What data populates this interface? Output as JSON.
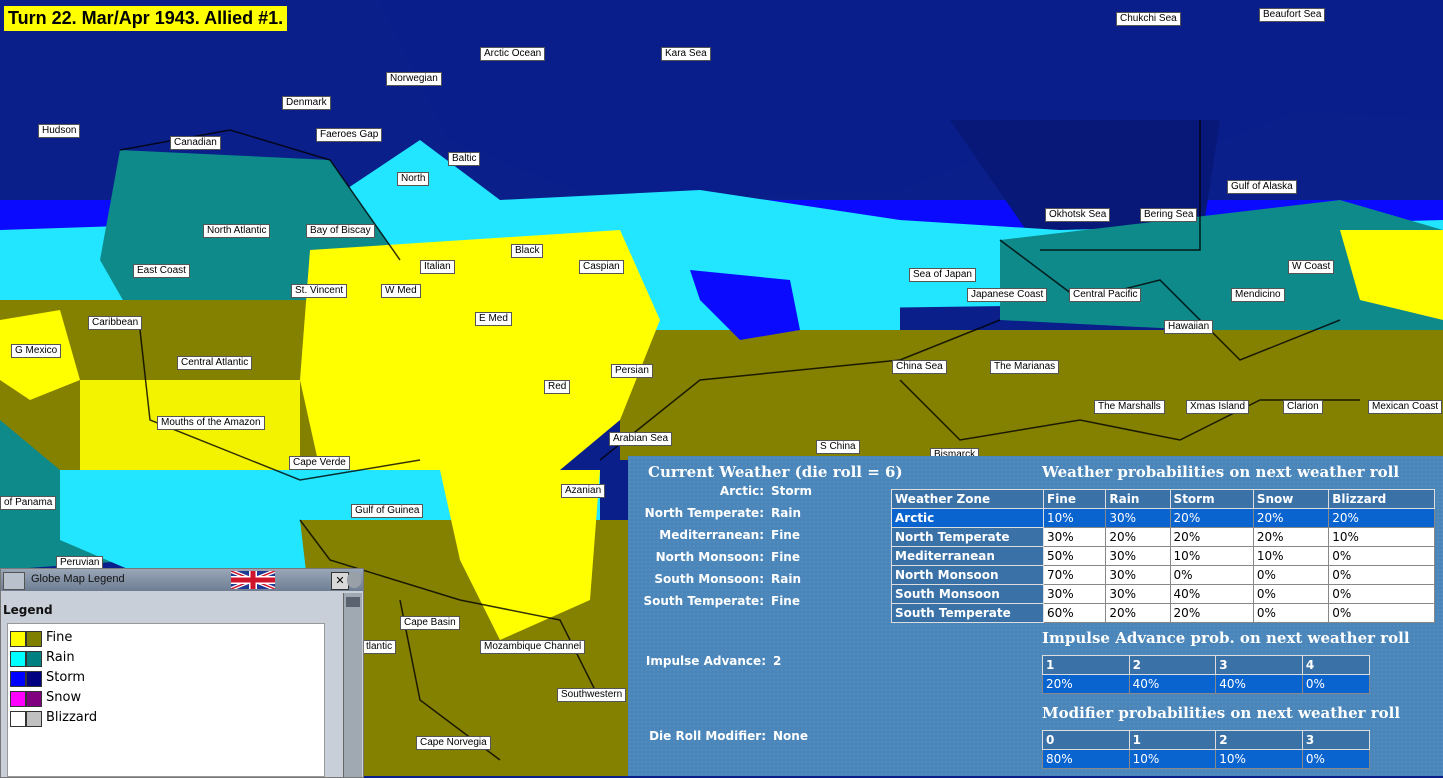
{
  "banner": "Turn 22.  Mar/Apr 1943.  Allied #1.",
  "map_labels": {
    "chukchi": "Chukchi Sea",
    "beaufort": "Beaufort Sea",
    "arctic_ocean": "Arctic Ocean",
    "kara": "Kara Sea",
    "norwegian": "Norwegian",
    "denmark": "Denmark",
    "hudson": "Hudson",
    "canadian": "Canadian",
    "faeroes": "Faeroes Gap",
    "baltic": "Baltic",
    "north": "North",
    "gulf_alaska": "Gulf of Alaska",
    "okhotsk": "Okhotsk Sea",
    "bering": "Bering Sea",
    "north_atlantic": "North Atlantic",
    "bay_biscay": "Bay of Biscay",
    "black": "Black",
    "east_coast": "East Coast",
    "italian": "Italian",
    "caspian": "Caspian",
    "sea_japan": "Sea of Japan",
    "w_coast": "W Coast",
    "st_vincent": "St. Vincent",
    "w_med": "W Med",
    "japanese_coast": "Japanese Coast",
    "central_pacific": "Central Pacific",
    "mendicino": "Mendicino",
    "caribbean": "Caribbean",
    "e_med": "E Med",
    "hawaiian": "Hawaiian",
    "g_mexico": "G Mexico",
    "central_atlantic": "Central Atlantic",
    "persian": "Persian",
    "china_sea": "China Sea",
    "marianas": "The Marianas",
    "red": "Red",
    "marshalls": "The Marshalls",
    "xmas": "Xmas Island",
    "clarion": "Clarion",
    "mexican_coast": "Mexican Coast",
    "amazon": "Mouths of the Amazon",
    "arabian": "Arabian Sea",
    "s_china": "S China",
    "bismarck": "Bismarck",
    "cape_verde": "Cape Verde",
    "azanian": "Azanian",
    "panama": "of Panama",
    "guinea": "Gulf of Guinea",
    "peruvian": "Peruvian",
    "cape_basin": "Cape Basin",
    "atlantic_partial": "tlantic",
    "mozambique": "Mozambique Channel",
    "southwestern": "Southwestern",
    "cape_norvegia": "Cape Norvegia"
  },
  "legend": {
    "window_title": "Globe Map Legend",
    "heading": "Legend",
    "close_label": "✕",
    "items": [
      {
        "label": "Fine",
        "colors": [
          "#ffff00",
          "#808000"
        ]
      },
      {
        "label": "Rain",
        "colors": [
          "#00ffff",
          "#008080"
        ]
      },
      {
        "label": "Storm",
        "colors": [
          "#0000ff",
          "#000080"
        ]
      },
      {
        "label": "Snow",
        "colors": [
          "#ff00ff",
          "#800080"
        ]
      },
      {
        "label": "Blizzard",
        "colors": [
          "#ffffff",
          "#c0c0c0"
        ]
      }
    ]
  },
  "weather": {
    "current_title": "Current Weather (die roll = 6)",
    "current": [
      {
        "zone": "Arctic:",
        "value": "Storm"
      },
      {
        "zone": "North Temperate:",
        "value": "Rain"
      },
      {
        "zone": "Mediterranean:",
        "value": "Fine"
      },
      {
        "zone": "North Monsoon:",
        "value": "Fine"
      },
      {
        "zone": "South Monsoon:",
        "value": "Rain"
      },
      {
        "zone": "South Temperate:",
        "value": "Fine"
      }
    ],
    "prob_title": "Weather probabilities on next weather roll",
    "prob_headers": [
      "Weather Zone",
      "Fine",
      "Rain",
      "Storm",
      "Snow",
      "Blizzard"
    ],
    "prob_rows": [
      [
        "Arctic",
        "10%",
        "30%",
        "20%",
        "20%",
        "20%"
      ],
      [
        "North Temperate",
        "30%",
        "20%",
        "20%",
        "20%",
        "10%"
      ],
      [
        "Mediterranean",
        "50%",
        "30%",
        "10%",
        "10%",
        "0%"
      ],
      [
        "North Monsoon",
        "70%",
        "30%",
        "0%",
        "0%",
        "0%"
      ],
      [
        "South Monsoon",
        "30%",
        "30%",
        "40%",
        "0%",
        "0%"
      ],
      [
        "South Temperate",
        "60%",
        "20%",
        "20%",
        "0%",
        "0%"
      ]
    ],
    "impulse_label": "Impulse Advance:",
    "impulse_value": "2",
    "impulse_title": "Impulse Advance prob. on next weather roll",
    "impulse_headers": [
      "1",
      "2",
      "3",
      "4"
    ],
    "impulse_values": [
      "20%",
      "40%",
      "40%",
      "0%"
    ],
    "modifier_label": "Die Roll Modifier:",
    "modifier_value": "None",
    "modifier_title": "Modifier probabilities on next weather roll",
    "modifier_headers": [
      "0",
      "1",
      "2",
      "3"
    ],
    "modifier_values": [
      "80%",
      "10%",
      "10%",
      "0%"
    ]
  }
}
